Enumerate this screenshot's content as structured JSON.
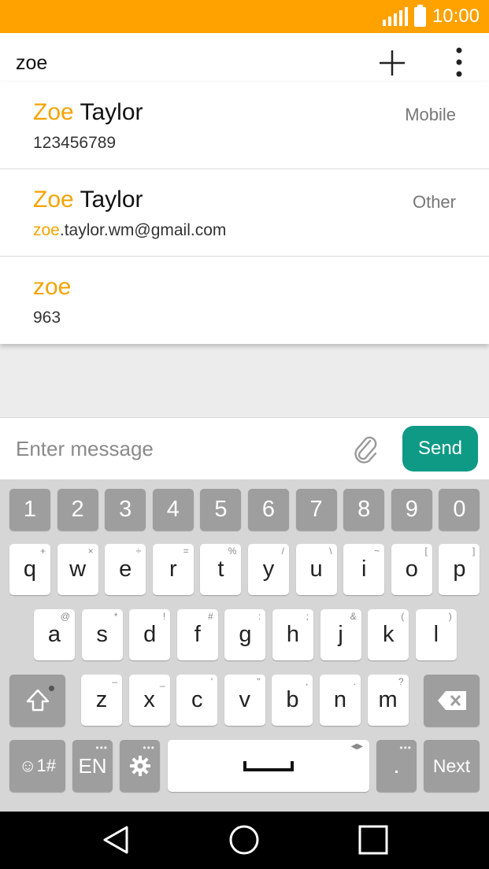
{
  "status": {
    "time": "10:00"
  },
  "recipient": {
    "text": "zoe"
  },
  "suggestions": [
    {
      "name_match": "Zoe",
      "name_rest": " Taylor",
      "detail_match": "",
      "detail_rest": "123456789",
      "type": "Mobile"
    },
    {
      "name_match": "Zoe",
      "name_rest": " Taylor",
      "detail_match": "zoe",
      "detail_rest": ".taylor.wm@gmail.com",
      "type": "Other"
    },
    {
      "name_match": "zoe",
      "name_rest": "",
      "detail_match": "",
      "detail_rest": "963",
      "type": ""
    }
  ],
  "composer": {
    "placeholder": "Enter message",
    "send_label": "Send"
  },
  "keyboard": {
    "numbers": [
      "1",
      "2",
      "3",
      "4",
      "5",
      "6",
      "7",
      "8",
      "9",
      "0"
    ],
    "row1": [
      {
        "k": "q",
        "s": "+"
      },
      {
        "k": "w",
        "s": "×"
      },
      {
        "k": "e",
        "s": "÷"
      },
      {
        "k": "r",
        "s": "="
      },
      {
        "k": "t",
        "s": "%"
      },
      {
        "k": "y",
        "s": "/"
      },
      {
        "k": "u",
        "s": "\\"
      },
      {
        "k": "i",
        "s": "~"
      },
      {
        "k": "o",
        "s": "["
      },
      {
        "k": "p",
        "s": "]"
      }
    ],
    "row2": [
      {
        "k": "a",
        "s": "@"
      },
      {
        "k": "s",
        "s": "*"
      },
      {
        "k": "d",
        "s": "!"
      },
      {
        "k": "f",
        "s": "#"
      },
      {
        "k": "g",
        "s": ":"
      },
      {
        "k": "h",
        "s": ";"
      },
      {
        "k": "j",
        "s": "&"
      },
      {
        "k": "k",
        "s": "("
      },
      {
        "k": "l",
        "s": ")"
      }
    ],
    "row3": [
      {
        "k": "z",
        "s": "–"
      },
      {
        "k": "x",
        "s": "_"
      },
      {
        "k": "c",
        "s": "'"
      },
      {
        "k": "v",
        "s": "\""
      },
      {
        "k": "b",
        "s": ","
      },
      {
        "k": "n",
        "s": "."
      },
      {
        "k": "m",
        "s": "?"
      }
    ],
    "symbols_label": "☺1#",
    "language_label": "EN",
    "period_label": ".",
    "next_label": "Next"
  },
  "icons": {
    "signal": "signal-icon",
    "battery": "battery-icon",
    "add": "add-icon",
    "menu": "more-vert-icon",
    "attach": "paperclip-icon",
    "shift": "shift-icon",
    "backspace": "backspace-icon",
    "settings": "gear-icon",
    "back": "back-icon",
    "home": "home-icon",
    "recents": "recents-icon"
  },
  "colors": {
    "status_bar": "#ffa200",
    "highlight": "#f5a300",
    "send": "#0f9a86"
  }
}
